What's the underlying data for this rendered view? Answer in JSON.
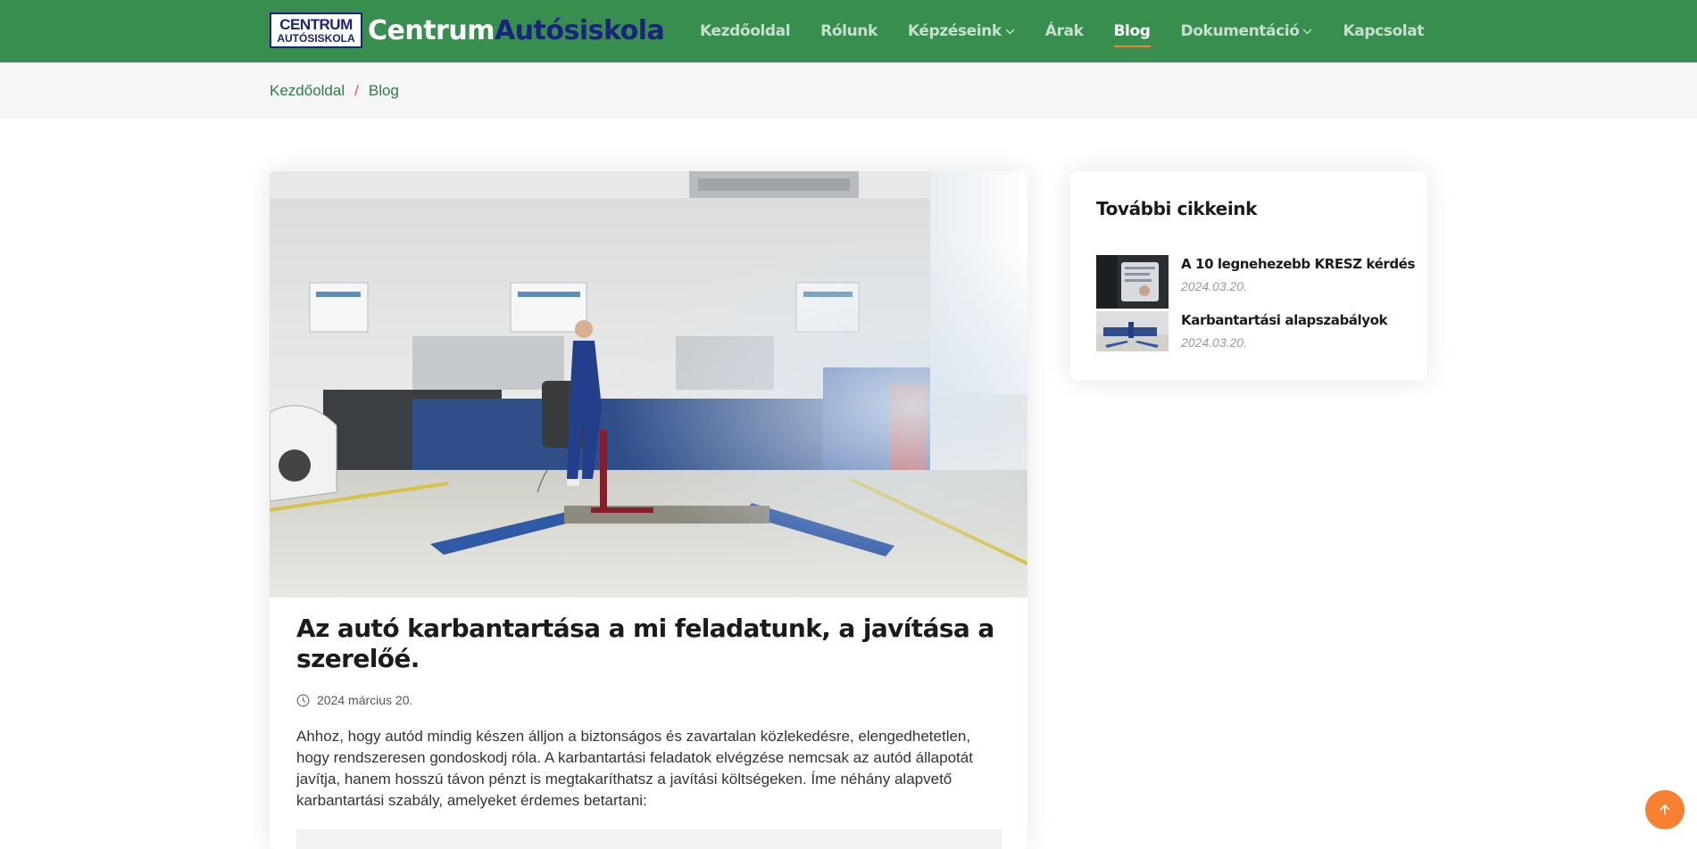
{
  "brand": {
    "badge_line1": "CENTRUM",
    "badge_line2": "AUTÓSISKOLA",
    "name_part1": "Centrum",
    "name_part2": "Autósiskola"
  },
  "nav": {
    "items": [
      {
        "label": "Kezdőoldal",
        "dropdown": false
      },
      {
        "label": "Rólunk",
        "dropdown": false
      },
      {
        "label": "Képzéseink",
        "dropdown": true
      },
      {
        "label": "Árak",
        "dropdown": false
      },
      {
        "label": "Blog",
        "dropdown": false,
        "active": true
      },
      {
        "label": "Dokumentáció",
        "dropdown": true
      },
      {
        "label": "Kapcsolat",
        "dropdown": false
      }
    ],
    "chevron_icon": "chevron-down-icon"
  },
  "breadcrumb": {
    "home": "Kezdőoldal",
    "separator": "/",
    "current": "Blog"
  },
  "article": {
    "title": "Az autó karbantartása a mi feladatunk, a javítása a szerelőé.",
    "date": "2024 március 20.",
    "date_icon": "clock-icon",
    "body": "Ahhoz, hogy autód mindig készen álljon a biztonságos és zavartalan közlekedésre, elengedhetetlen, hogy rendszeresen gondoskodj róla. A karbantartási feladatok elvégzése nemcsak az autód állapotát javítja, hanem hosszú távon pénzt is megtakaríthatsz a javítási költségeken. Íme néhány alapvető karbantartási szabály, amelyeket érdemes betartani:"
  },
  "sidebar": {
    "title": "További cikkeink",
    "posts": [
      {
        "title": "A 10 legnehezebb KRESZ kérdés",
        "date": "2024.03.20."
      },
      {
        "title": "Karbantartási alapszabályok",
        "date": "2024.03.20."
      }
    ]
  },
  "back_to_top": {
    "icon": "arrow-up-icon"
  },
  "colors": {
    "header_bg": "#388e4f",
    "accent": "#f5802f",
    "brand_navy": "#1a237e",
    "breadcrumb_link": "#2e7d46"
  }
}
